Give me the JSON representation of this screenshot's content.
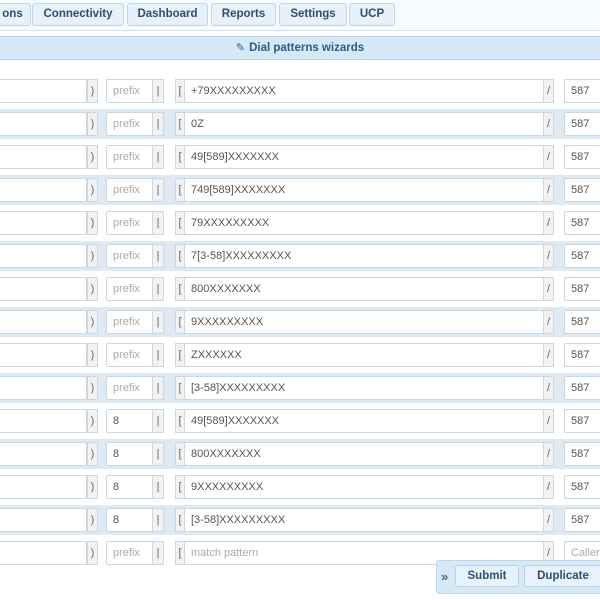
{
  "nav": {
    "tabs": [
      {
        "label": "ons"
      },
      {
        "label": "Connectivity"
      },
      {
        "label": "Dashboard"
      },
      {
        "label": "Reports"
      },
      {
        "label": "Settings"
      },
      {
        "label": "UCP"
      }
    ]
  },
  "wizard": {
    "label": "Dial patterns wizards",
    "icon": "pencil-icon"
  },
  "separators": {
    "close_paren": ")",
    "pipe": "|",
    "open_bracket": "[",
    "slash": "/"
  },
  "rows": [
    {
      "prefix": "",
      "prefix_placeholder": "prefix",
      "pattern": "+79XXXXXXXXX",
      "callerid": "587"
    },
    {
      "prefix": "",
      "prefix_placeholder": "prefix",
      "pattern": "0Z",
      "callerid": "587"
    },
    {
      "prefix": "",
      "prefix_placeholder": "prefix",
      "pattern": "49[589]XXXXXXX",
      "callerid": "587"
    },
    {
      "prefix": "",
      "prefix_placeholder": "prefix",
      "pattern": "749[589]XXXXXXX",
      "callerid": "587"
    },
    {
      "prefix": "",
      "prefix_placeholder": "prefix",
      "pattern": "79XXXXXXXXX",
      "callerid": "587"
    },
    {
      "prefix": "",
      "prefix_placeholder": "prefix",
      "pattern": "7[3-58]XXXXXXXXX",
      "callerid": "587"
    },
    {
      "prefix": "",
      "prefix_placeholder": "prefix",
      "pattern": "800XXXXXXX",
      "callerid": "587"
    },
    {
      "prefix": "",
      "prefix_placeholder": "prefix",
      "pattern": "9XXXXXXXXX",
      "callerid": "587"
    },
    {
      "prefix": "",
      "prefix_placeholder": "prefix",
      "pattern": "ZXXXXXX",
      "callerid": "587"
    },
    {
      "prefix": "",
      "prefix_placeholder": "prefix",
      "pattern": "[3-58]XXXXXXXXX",
      "callerid": "587"
    },
    {
      "prefix": "8",
      "prefix_placeholder": "prefix",
      "pattern": "49[589]XXXXXXX",
      "callerid": "587"
    },
    {
      "prefix": "8",
      "prefix_placeholder": "prefix",
      "pattern": "800XXXXXXX",
      "callerid": "587"
    },
    {
      "prefix": "8",
      "prefix_placeholder": "prefix",
      "pattern": "9XXXXXXXXX",
      "callerid": "587"
    },
    {
      "prefix": "8",
      "prefix_placeholder": "prefix",
      "pattern": "[3-58]XXXXXXXXX",
      "callerid": "587"
    }
  ],
  "new_row": {
    "prefix_placeholder": "prefix",
    "pattern_placeholder": "match pattern",
    "callerid_placeholder": "Callerid"
  },
  "actions": {
    "expand_icon": "double-chevron-right-icon",
    "expand_glyph": "»",
    "submit_label": "Submit",
    "duplicate_label": "Duplicate"
  }
}
